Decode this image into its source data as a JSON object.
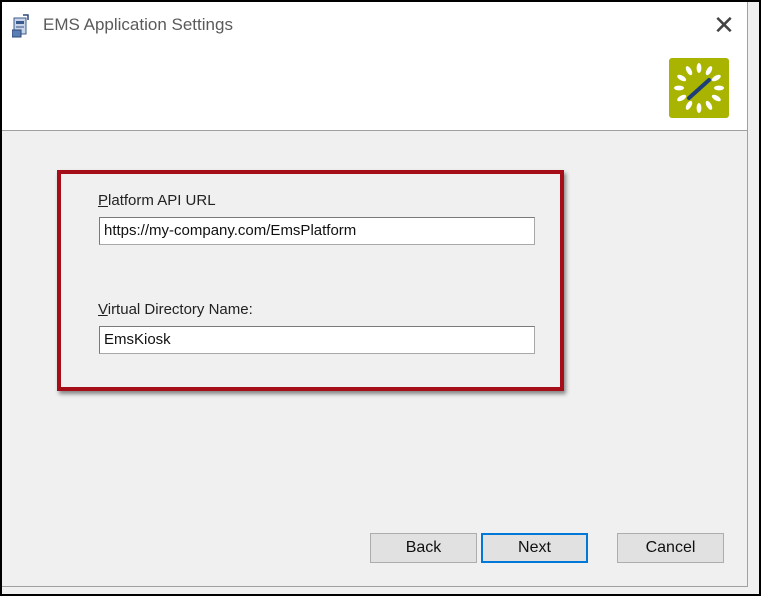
{
  "window": {
    "title": "EMS Application Settings",
    "close_glyph": "✕",
    "app_icon": "installer-icon",
    "logo_icon": "ems-sun-logo-icon",
    "logo_color": "#a8b400"
  },
  "form": {
    "highlight_color": "#a50e18",
    "platform_url": {
      "label_first": "P",
      "label_rest": "latform API URL",
      "value": "https://my-company.com/EmsPlatform"
    },
    "virtual_dir": {
      "label_first": "V",
      "label_rest": "irtual Directory Name:",
      "value": "EmsKiosk"
    }
  },
  "buttons": {
    "back": "Back",
    "next": "Next",
    "cancel": "Cancel"
  }
}
